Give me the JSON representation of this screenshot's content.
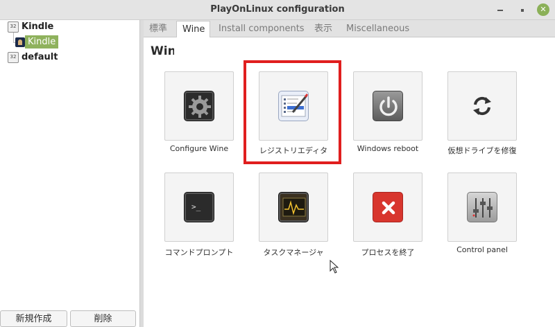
{
  "window": {
    "title": "PlayOnLinux configuration"
  },
  "sidebar": {
    "items": [
      {
        "badge": "32",
        "label": "Kindle"
      },
      {
        "label": "Kindle",
        "selected": true
      },
      {
        "badge": "32",
        "label": "default"
      }
    ],
    "new_button": "新規作成",
    "delete_button": "削除"
  },
  "tabs": [
    {
      "label": "標準"
    },
    {
      "label": "Wine",
      "active": true
    },
    {
      "label": "Install components"
    },
    {
      "label": "表示"
    },
    {
      "label": "Miscellaneous"
    }
  ],
  "section_title": "Wine",
  "tools": [
    {
      "label": "Configure Wine",
      "icon": "gears-icon"
    },
    {
      "label": "レジストリエディタ",
      "icon": "registry-editor-icon"
    },
    {
      "label": "Windows reboot",
      "icon": "power-icon"
    },
    {
      "label": "仮想ドライブを修復",
      "icon": "refresh-icon"
    },
    {
      "label": "コマンドプロンプト",
      "icon": "terminal-icon"
    },
    {
      "label": "タスクマネージャ",
      "icon": "task-manager-icon"
    },
    {
      "label": "プロセスを終了",
      "icon": "kill-process-icon"
    },
    {
      "label": "Control panel",
      "icon": "control-panel-icon"
    }
  ],
  "colors": {
    "selection": "#8fb25d",
    "highlight_box": "#e01e1e",
    "close_button": "#8bb058"
  }
}
